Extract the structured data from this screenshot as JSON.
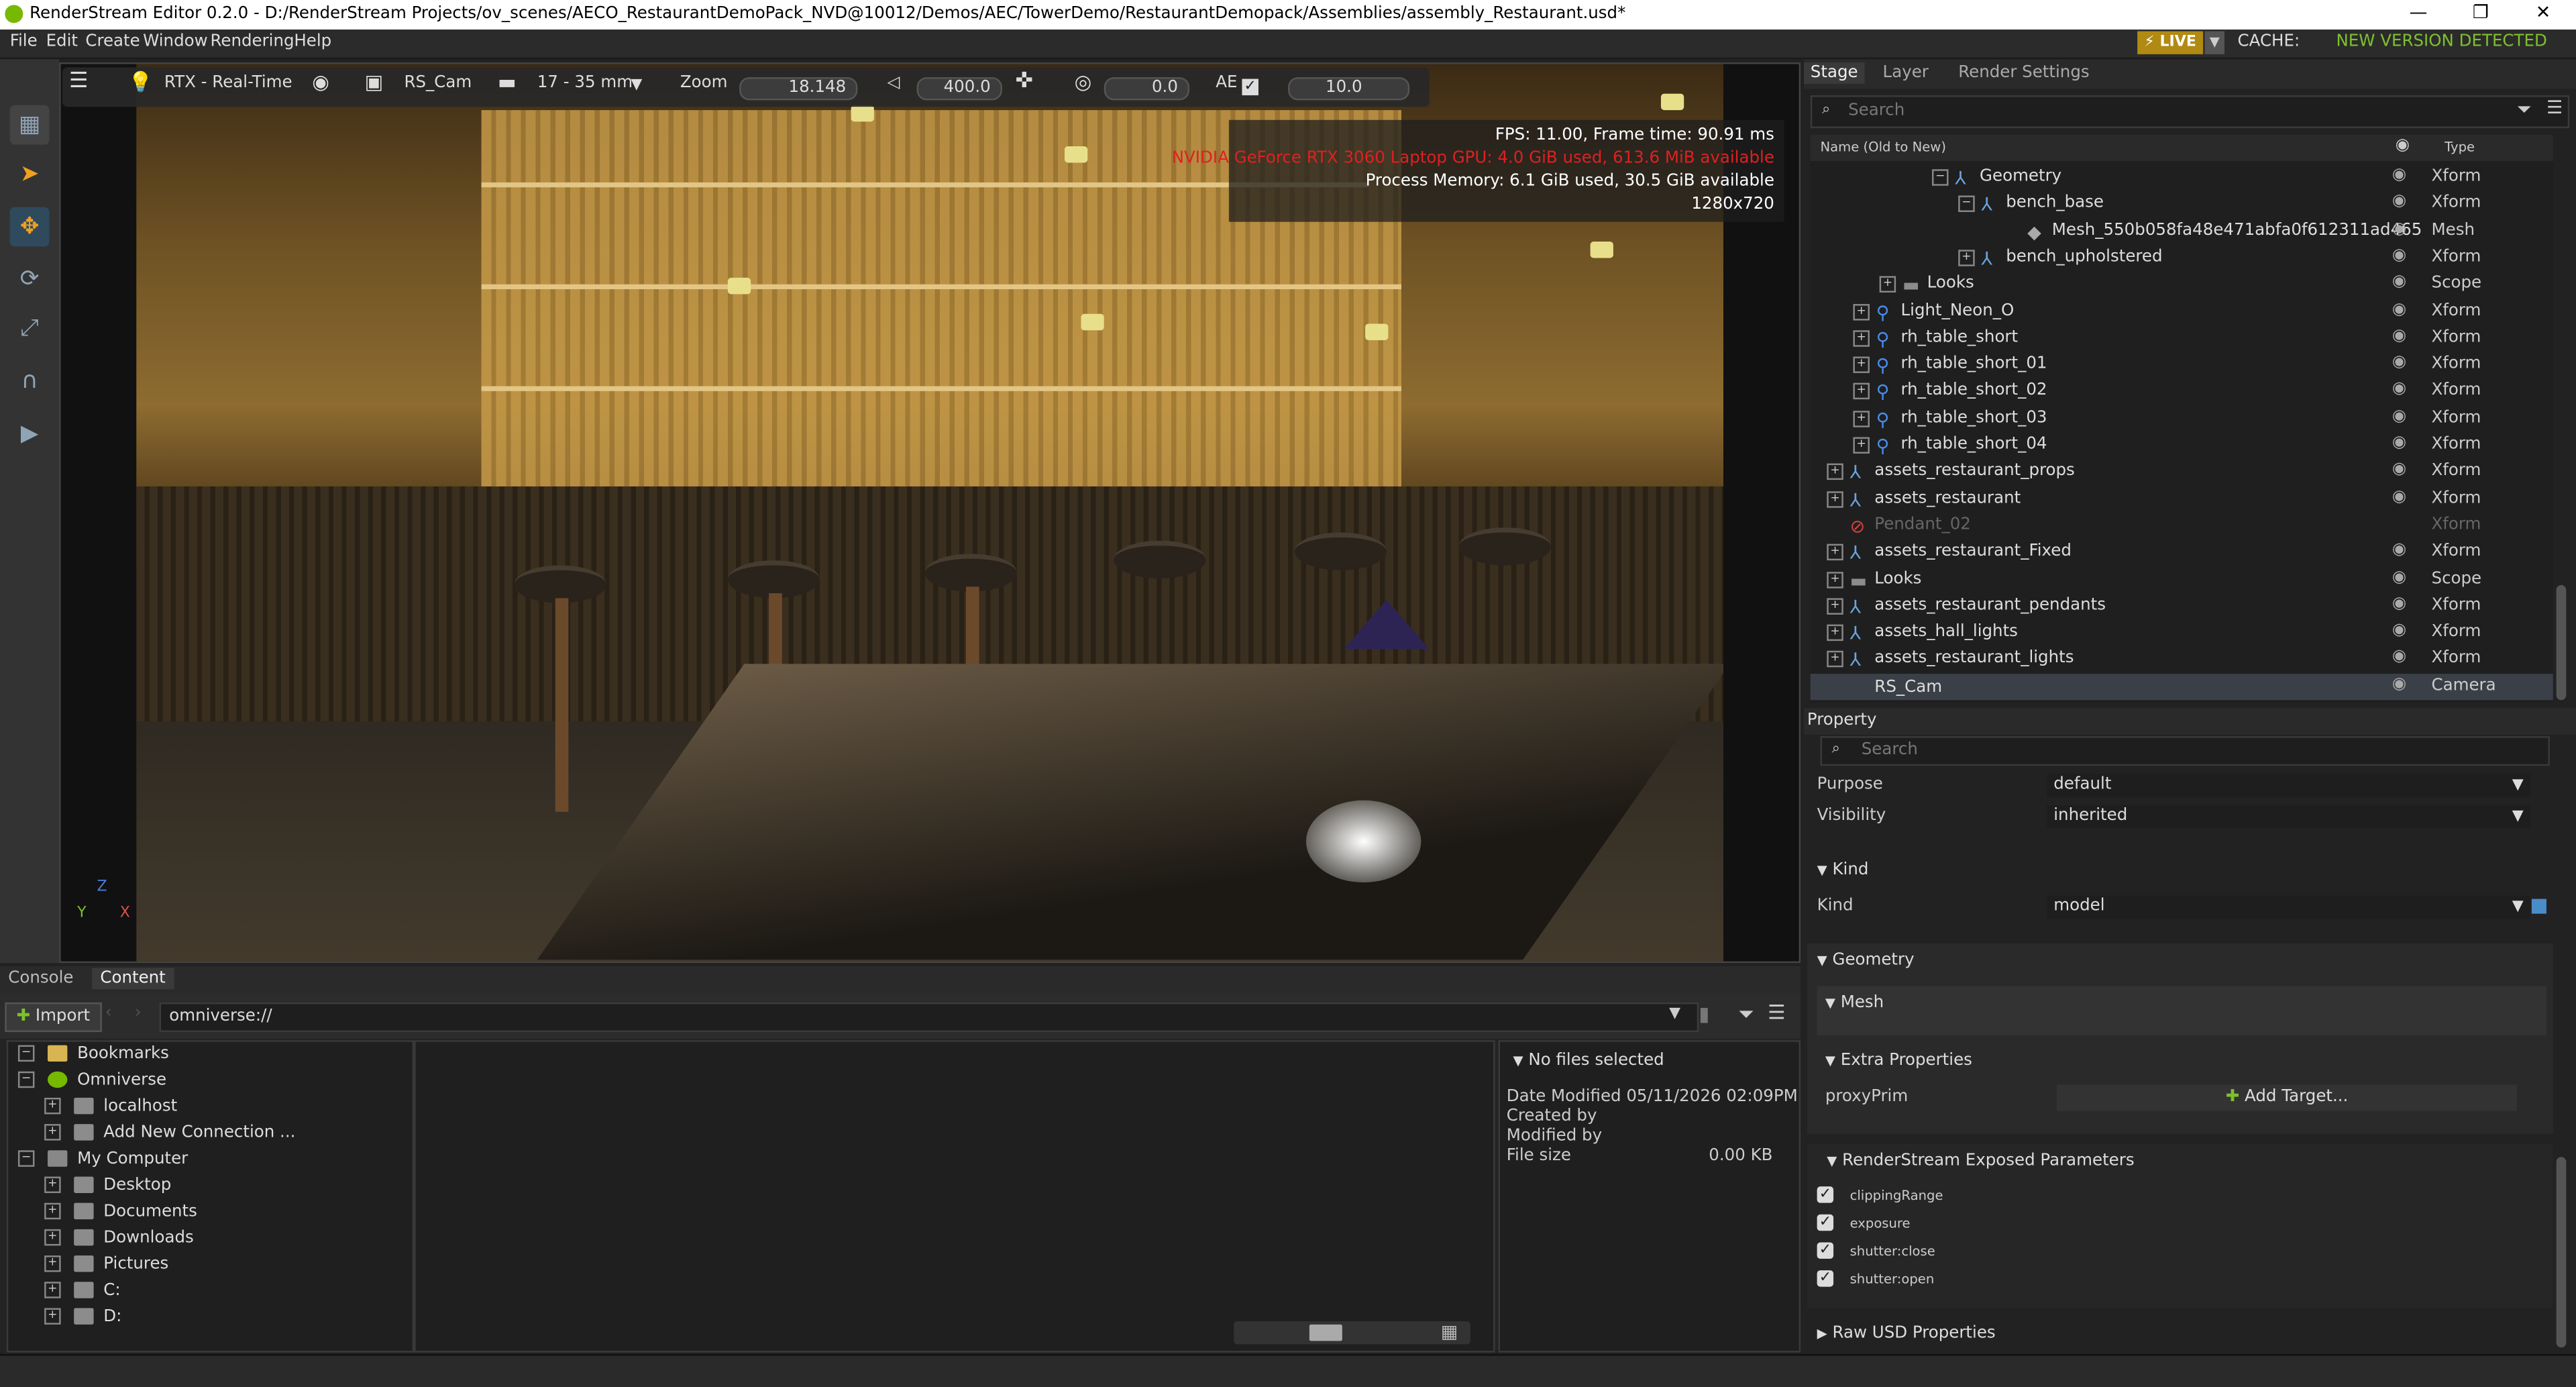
{
  "window": {
    "title": "RenderStream Editor 0.2.0 - D:/RenderStream Projects/ov_scenes/AECO_RestaurantDemoPack_NVD@10012/Demos/AEC/TowerDemo/RestaurantDemopack/Assemblies/assembly_Restaurant.usd*",
    "minimize": "—",
    "maximize": "❐",
    "close": "✕"
  },
  "menubar": {
    "items": [
      "File",
      "Edit",
      "Create",
      "Window",
      "Rendering",
      "Help"
    ],
    "live_label": "LIVE",
    "cache_label": "CACHE:",
    "cache_status": "NEW VERSION DETECTED"
  },
  "viewport_toolbar": {
    "renderer": "RTX - Real-Time",
    "camera": "RS_Cam",
    "lens": "17 - 35 mm",
    "zoom_label": "Zoom",
    "zoom_value": "18.148",
    "focal_value": "400.0",
    "rotate_value": "0.0",
    "ae_label": "AE",
    "ae_value": "10.0"
  },
  "stats": {
    "fps": "FPS: 11.00, Frame time: 90.91 ms",
    "gpu": "NVIDIA GeForce RTX 3060 Laptop GPU: 4.0 GiB used, 613.6 MiB available",
    "memory": "Process Memory: 6.1 GiB used, 30.5 GiB available",
    "resolution": "1280x720"
  },
  "axis": {
    "z": "Z",
    "y": "Y",
    "x": "X"
  },
  "bottom_tabs": [
    "Console",
    "Content"
  ],
  "content": {
    "import_label": "Import",
    "path": "omniverse://",
    "tree": [
      {
        "label": "Bookmarks",
        "level": 0
      },
      {
        "label": "Omniverse",
        "level": 0
      },
      {
        "label": "localhost",
        "level": 1
      },
      {
        "label": "Add New Connection ...",
        "level": 1
      },
      {
        "label": "My Computer",
        "level": 0
      },
      {
        "label": "Desktop",
        "level": 1
      },
      {
        "label": "Documents",
        "level": 1
      },
      {
        "label": "Downloads",
        "level": 1
      },
      {
        "label": "Pictures",
        "level": 1
      },
      {
        "label": "C:",
        "level": 1
      },
      {
        "label": "D:",
        "level": 1
      }
    ],
    "info": {
      "header": "No files selected",
      "date_modified": "Date Modified 05/11/2026 02:09PM",
      "created_by": "Created by",
      "modified_by": "Modified by",
      "file_size_label": "File size",
      "file_size_value": "0.00 KB"
    }
  },
  "right_tabs": [
    "Stage",
    "Layer",
    "Render Settings"
  ],
  "stage": {
    "search_placeholder": "Search",
    "col_name": "Name (Old to New)",
    "col_type": "Type",
    "rows": [
      {
        "name": "Geometry",
        "indent": 88,
        "type": "Xform",
        "icon": "xform"
      },
      {
        "name": "bench_base",
        "indent": 104,
        "type": "Xform",
        "icon": "xform"
      },
      {
        "name": "Mesh_550b058fa48e471abfa0f612311ad465",
        "indent": 132,
        "type": "Mesh",
        "icon": "mesh"
      },
      {
        "name": "bench_upholstered",
        "indent": 104,
        "type": "Xform",
        "icon": "xform"
      },
      {
        "name": "Looks",
        "indent": 56,
        "type": "Scope",
        "icon": "folder"
      },
      {
        "name": "Light_Neon_O",
        "indent": 40,
        "type": "Xform",
        "icon": "light"
      },
      {
        "name": "rh_table_short",
        "indent": 40,
        "type": "Xform",
        "icon": "light"
      },
      {
        "name": "rh_table_short_01",
        "indent": 40,
        "type": "Xform",
        "icon": "light"
      },
      {
        "name": "rh_table_short_02",
        "indent": 40,
        "type": "Xform",
        "icon": "light"
      },
      {
        "name": "rh_table_short_03",
        "indent": 40,
        "type": "Xform",
        "icon": "light"
      },
      {
        "name": "rh_table_short_04",
        "indent": 40,
        "type": "Xform",
        "icon": "light"
      },
      {
        "name": "assets_restaurant_props",
        "indent": 24,
        "type": "Xform",
        "icon": "xform"
      },
      {
        "name": "assets_restaurant",
        "indent": 24,
        "type": "Xform",
        "icon": "xform"
      },
      {
        "name": "Pendant_02",
        "indent": 24,
        "type": "Xform",
        "icon": "disabled"
      },
      {
        "name": "assets_restaurant_Fixed",
        "indent": 24,
        "type": "Xform",
        "icon": "xform"
      },
      {
        "name": "Looks",
        "indent": 24,
        "type": "Scope",
        "icon": "folder"
      },
      {
        "name": "assets_restaurant_pendants",
        "indent": 24,
        "type": "Xform",
        "icon": "xform"
      },
      {
        "name": "assets_hall_lights",
        "indent": 24,
        "type": "Xform",
        "icon": "xform"
      },
      {
        "name": "assets_restaurant_lights",
        "indent": 24,
        "type": "Xform",
        "icon": "xform"
      },
      {
        "name": "RS_Cam",
        "indent": 24,
        "type": "Camera",
        "icon": "camera"
      }
    ]
  },
  "property": {
    "title": "Property",
    "search_placeholder": "Search",
    "purpose_label": "Purpose",
    "purpose_value": "default",
    "visibility_label": "Visibility",
    "visibility_value": "inherited",
    "kind_section": "Kind",
    "kind_label": "Kind",
    "kind_value": "model",
    "geometry_section": "Geometry",
    "mesh_section": "Mesh",
    "extra_section": "Extra Properties",
    "proxyprim_label": "proxyPrim",
    "add_target_label": "Add Target...",
    "rs_section": "RenderStream Exposed Parameters",
    "rs_params": [
      "clippingRange",
      "exposure",
      "shutter:close",
      "shutter:open"
    ],
    "raw_section": "Raw USD Properties"
  },
  "colors": {
    "accent_live": "#b08a12",
    "new_version": "#7ec12e",
    "gpu_warning": "#e02020",
    "selection": "#3b4048"
  }
}
